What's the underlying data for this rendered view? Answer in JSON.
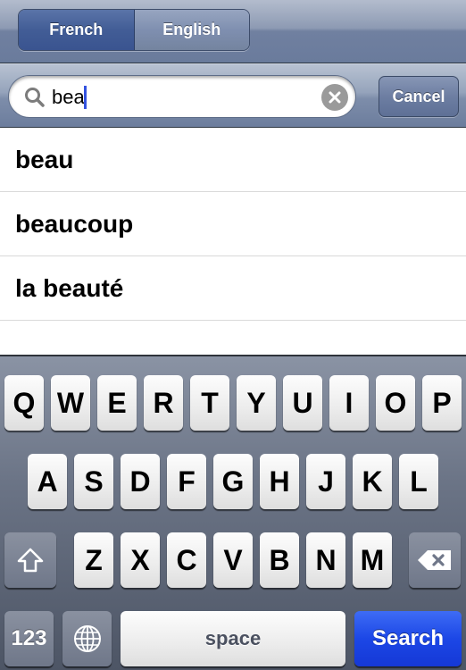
{
  "language_toggle": {
    "options": [
      {
        "label": "French",
        "selected": true
      },
      {
        "label": "English",
        "selected": false
      }
    ]
  },
  "search": {
    "query": "bea",
    "cancel_label": "Cancel",
    "search_icon": "magnifier-icon",
    "clear_icon": "clear-x-icon"
  },
  "results": [
    {
      "label": "beau"
    },
    {
      "label": "beaucoup"
    },
    {
      "label": "la beauté"
    }
  ],
  "keyboard": {
    "row1": [
      "Q",
      "W",
      "E",
      "R",
      "T",
      "Y",
      "U",
      "I",
      "O",
      "P"
    ],
    "row2": [
      "A",
      "S",
      "D",
      "F",
      "G",
      "H",
      "J",
      "K",
      "L"
    ],
    "row3": [
      "Z",
      "X",
      "C",
      "V",
      "B",
      "N",
      "M"
    ],
    "shift_icon": "shift-arrow-icon",
    "backspace_icon": "backspace-icon",
    "numbers_label": "123",
    "globe_icon": "globe-icon",
    "space_label": "space",
    "search_label": "Search",
    "colors": {
      "search_key": "#1c47e6"
    }
  }
}
